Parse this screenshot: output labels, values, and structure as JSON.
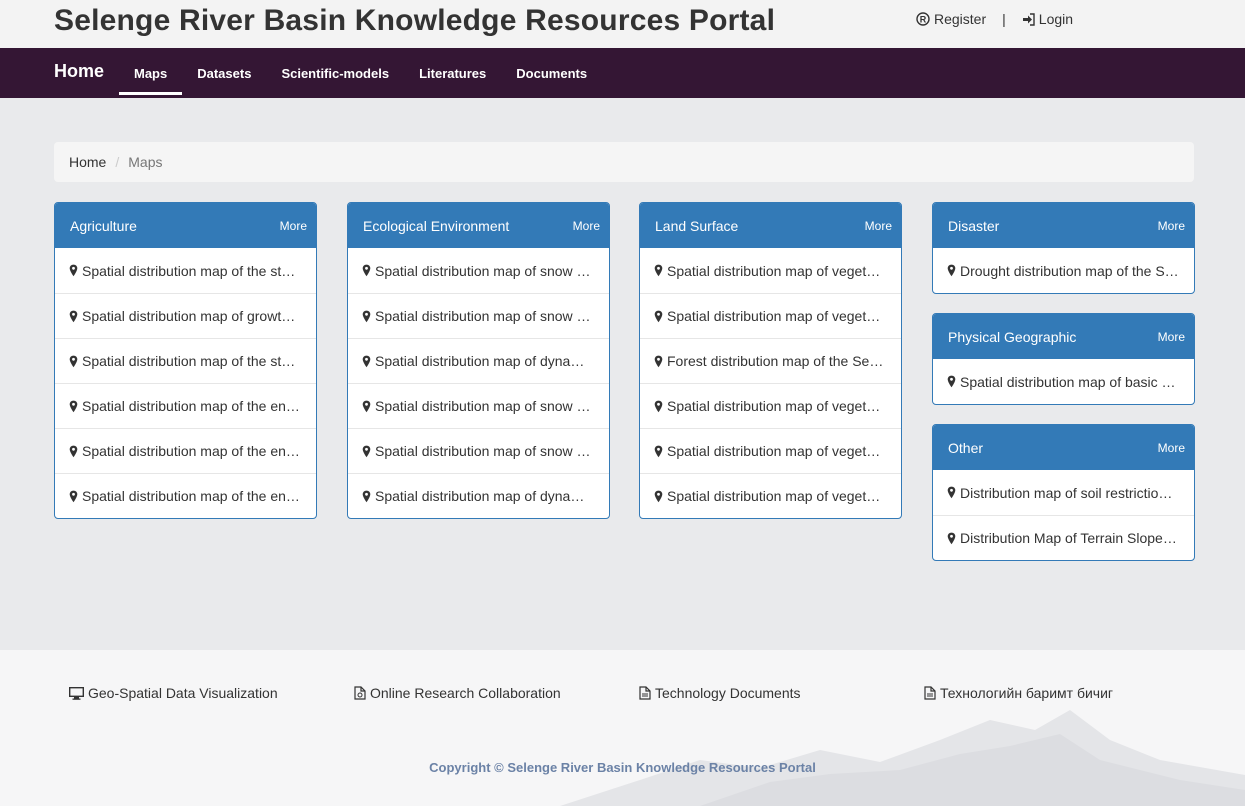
{
  "header": {
    "title": "Selenge River Basin Knowledge Resources Portal",
    "register_label": "Register",
    "separator": "|",
    "login_label": "Login"
  },
  "nav": {
    "brand": "Home",
    "items": [
      {
        "label": "Maps",
        "active": true
      },
      {
        "label": "Datasets",
        "active": false
      },
      {
        "label": "Scientific-models",
        "active": false
      },
      {
        "label": "Literatures",
        "active": false
      },
      {
        "label": "Documents",
        "active": false
      }
    ]
  },
  "breadcrumb": {
    "home": "Home",
    "separator": "/",
    "current": "Maps"
  },
  "panels": {
    "agriculture": {
      "title": "Agriculture",
      "more": "More",
      "items": [
        "Spatial distribution map of the st…",
        "Spatial distribution map of growt…",
        "Spatial distribution map of the st…",
        "Spatial distribution map of the en…",
        "Spatial distribution map of the en…",
        "Spatial distribution map of the en…"
      ]
    },
    "ecology": {
      "title": "Ecological Environment",
      "more": "More",
      "items": [
        "Spatial distribution map of snow …",
        "Spatial distribution map of snow …",
        "Spatial distribution map of dyna…",
        "Spatial distribution map of snow …",
        "Spatial distribution map of snow …",
        "Spatial distribution map of dyna…"
      ]
    },
    "land": {
      "title": "Land Surface",
      "more": "More",
      "items": [
        "Spatial distribution map of veget…",
        "Spatial distribution map of veget…",
        "Forest distribution map of the Se…",
        "Spatial distribution map of veget…",
        "Spatial distribution map of veget…",
        "Spatial distribution map of veget…"
      ]
    },
    "disaster": {
      "title": "Disaster",
      "more": "More",
      "items": [
        "Drought distribution map of the S…"
      ]
    },
    "physical": {
      "title": "Physical Geographic",
      "more": "More",
      "items": [
        "Spatial distribution map of basic …"
      ]
    },
    "other": {
      "title": "Other",
      "more": "More",
      "items": [
        "Distribution map of soil restrictio…",
        "Distribution Map of Terrain Slope…"
      ]
    }
  },
  "footer": {
    "links": [
      "Geo-Spatial Data Visualization",
      "Online Research Collaboration",
      "Technology Documents",
      "Технологийн баримт бичиг"
    ],
    "copyright": "Copyright © Selenge River Basin Knowledge Resources Portal"
  },
  "colors": {
    "navbar": "#341634",
    "panel_header": "#337ab7",
    "copyright": "#6b82a6"
  }
}
